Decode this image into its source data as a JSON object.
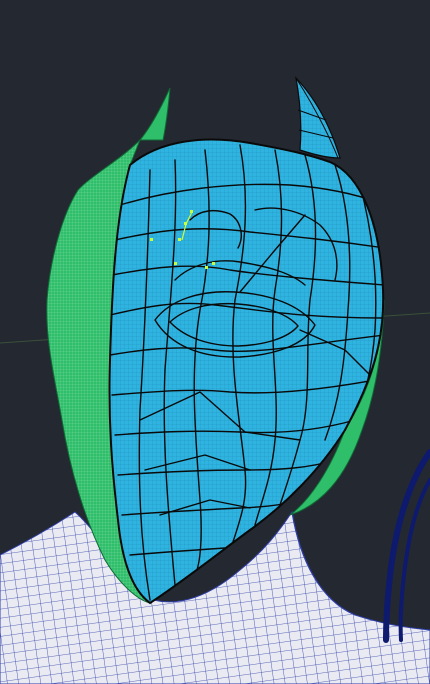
{
  "viewport": {
    "background_color": "#242830",
    "colors": {
      "helmet_face": "#2fb3e0",
      "helmet_face_dark": "#1e8fbf",
      "helmet_side": "#2fbf6a",
      "helmet_side_dark": "#1f9a52",
      "body_mesh_fill": "#e9eaf2",
      "body_mesh_lines": "#2f3ea8",
      "dark_tube": "#0d1a6e",
      "mesh_outline": "#0a0a0a",
      "selected_vertex": "#c8ff3a",
      "horizon_line": "#3f5a3f"
    },
    "objects": [
      "helmet-face-mesh",
      "helmet-side-mesh",
      "helmet-horn-left",
      "helmet-horn-right",
      "body-shoulder-mesh",
      "dark-tube"
    ]
  }
}
